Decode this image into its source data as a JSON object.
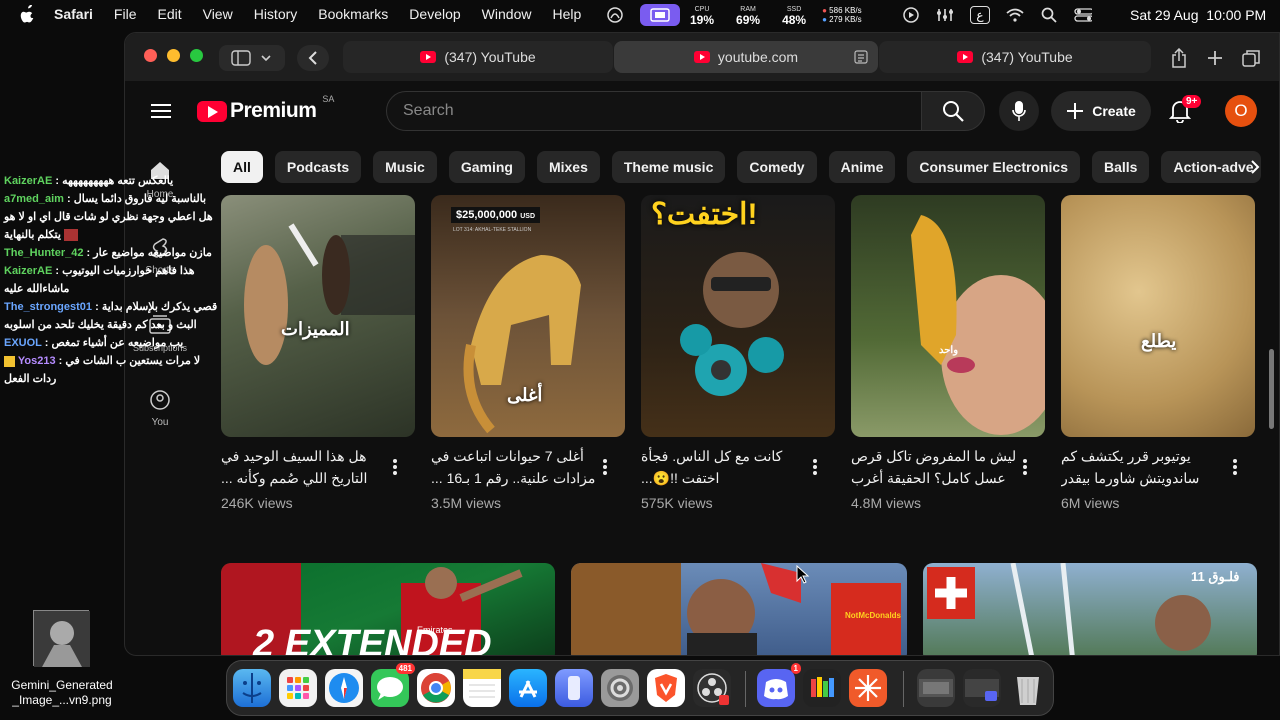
{
  "menubar": {
    "app": "Safari",
    "menus": [
      "File",
      "Edit",
      "View",
      "History",
      "Bookmarks",
      "Develop",
      "Window",
      "Help"
    ],
    "cpu_label": "CPU",
    "cpu_value": "19%",
    "ram_label": "RAM",
    "ram_value": "69%",
    "ssd_label": "SSD",
    "ssd_value": "48%",
    "net_up": "586 KB/s",
    "net_down": "279 KB/s",
    "datetime": "Sat 29 Aug  10:00 PM",
    "input_source": "ع"
  },
  "browser": {
    "tabs": [
      {
        "label": "(347) YouTube"
      },
      {
        "label": "youtube.com"
      },
      {
        "label": "(347) YouTube"
      }
    ]
  },
  "youtube": {
    "logo_text": "Premium",
    "region": "SA",
    "search_placeholder": "Search",
    "create_label": "Create",
    "notif_badge": "9+",
    "avatar_letter": "O",
    "chips": [
      "All",
      "Podcasts",
      "Music",
      "Gaming",
      "Mixes",
      "Theme music",
      "Comedy",
      "Anime",
      "Consumer Electronics",
      "Balls",
      "Action-adve"
    ],
    "sidebar": {
      "home": "Home",
      "shorts": "Shorts",
      "subscriptions": "Subscriptions",
      "you": "You"
    },
    "videos": [
      {
        "title": "هل هذا السيف الوحيد في التاريخ اللي صُمم وكأنه ...",
        "views": "246K views",
        "overlay": "المميزات"
      },
      {
        "title": "أغلى 7 حيوانات اتباعت في مزادات علنية.. رقم 1 بـ16 ...",
        "views": "3.5M views",
        "overlay": "أغلى",
        "price": "$25,000,000",
        "price_unit": "USD",
        "lot": "LOT 314: AKHAL-TEKE STALLION"
      },
      {
        "title": "كانت مع كل الناس. فجأة اختفت !!😮...",
        "views": "575K views",
        "overlay": "اختفت؟!"
      },
      {
        "title": "ليش ما المفروض تاكل قرص عسل كامل؟ الحقيقة أغرب مما ...",
        "views": "4.8M views",
        "overlay": "واحد"
      },
      {
        "title": "يوتيوبر قرر يكتشف كم ساندويتش شاورما بيقدر يصنع ...",
        "views": "6M views",
        "overlay": "يطلع"
      }
    ],
    "row2": [
      {
        "overlay": "2 EXTENDED",
        "sponsor": "Emirates"
      },
      {
        "overlay": "NotMcDonalds"
      },
      {
        "overlay": "فلـوق 11"
      }
    ]
  },
  "chat": [
    {
      "user": "KaizerAE",
      "text": "يالعكس تتعه هههههههههه",
      "color": "green"
    },
    {
      "user": "a7med_aim",
      "text": "بالناسبة ليه فاروق دائما يسال هل اعطي وجهة نظري لو شات قال اي او لا هو يتكلم بالنهاية",
      "color": "green"
    },
    {
      "user": "The_Hunter_42",
      "text": "مازن مواضيعه مواضيع عار",
      "color": "green"
    },
    {
      "user": "KaizerAE",
      "text": "هذا فاهم خوارزميات اليوتيوب ماشاءالله عليه",
      "color": "green"
    },
    {
      "user": "The_strongest01",
      "text": "قصي يذكرك بلإسلام بداية البث و بعد كم دقيقة يخليك تلحد من اسلوبه",
      "color": "blue"
    },
    {
      "user": "EXUOL",
      "text": "يب مواضيعه عن أشياء تمغص",
      "color": "blue"
    },
    {
      "user": "Yos213",
      "text": "لا مرات يستعين ب الشات في ردات الفعل",
      "color": "purple"
    }
  ],
  "desktop_file": {
    "name_line1": "Gemini_Generated",
    "name_line2": "_Image_...vn9.png"
  },
  "dock": {
    "messages_badge": "481",
    "discord_badge": "1"
  }
}
